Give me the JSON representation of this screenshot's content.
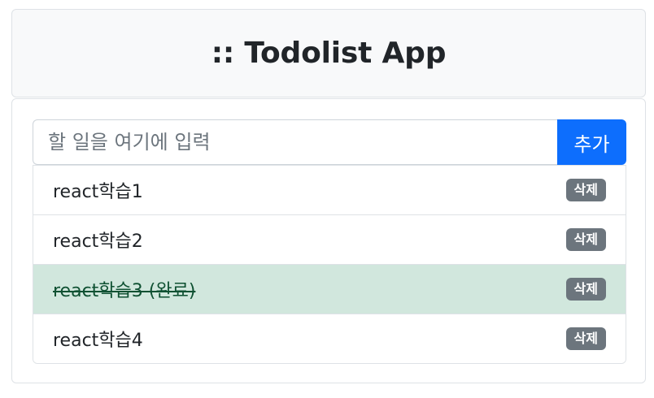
{
  "header": {
    "title": ":: Todolist App"
  },
  "input": {
    "placeholder": "할 일을 여기에 입력",
    "value": ""
  },
  "add_button": {
    "label": "추가"
  },
  "todos": [
    {
      "text": "react학습1",
      "done": false,
      "delete_label": "삭제"
    },
    {
      "text": "react학습2",
      "done": false,
      "delete_label": "삭제"
    },
    {
      "text": "react학습3 (완료)",
      "done": true,
      "delete_label": "삭제"
    },
    {
      "text": "react학습4",
      "done": false,
      "delete_label": "삭제"
    }
  ],
  "colors": {
    "primary": "#0d6efd",
    "done_bg": "#d1e7dd",
    "badge_bg": "#6c757d"
  }
}
